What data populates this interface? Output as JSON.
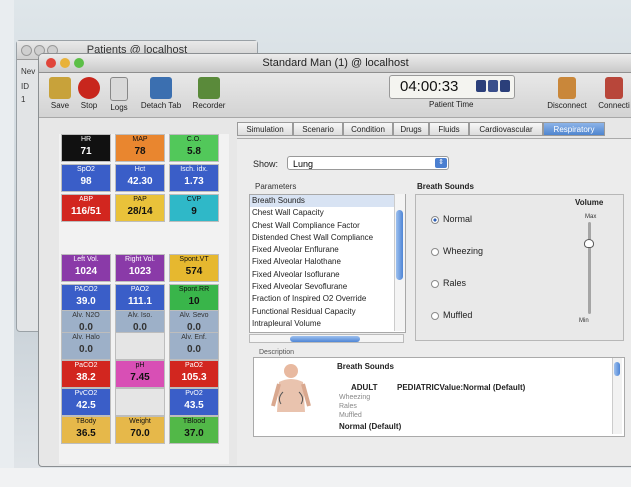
{
  "back_window": {
    "title": "Patients @ localhost",
    "side": [
      "Nev",
      "ID",
      "1"
    ]
  },
  "window": {
    "title": "Standard Man (1) @ localhost"
  },
  "toolbar": {
    "buttons": [
      {
        "label": "Save",
        "icon": "save-icon",
        "color": "#c8a23a"
      },
      {
        "label": "Stop",
        "icon": "stop-icon",
        "color": "#c8261d"
      },
      {
        "label": "Logs",
        "icon": "logs-icon",
        "color": "#d9d9d9"
      },
      {
        "label": "Detach Tab",
        "icon": "detach-tab-icon",
        "color": "#3b6fb0"
      },
      {
        "label": "Recorder",
        "icon": "recorder-icon",
        "color": "#5a8a3a"
      }
    ],
    "clock": "04:00:33",
    "patient_time_label": "Patient Time",
    "disconnect": "Disconnect",
    "connect": "Connecti"
  },
  "vitals": [
    {
      "label": "HR",
      "value": "71",
      "bg": "#111111",
      "fg": "#ffffff"
    },
    {
      "label": "MAP",
      "value": "78",
      "bg": "#e9862f",
      "fg": "#111111"
    },
    {
      "label": "C.O.",
      "value": "5.8",
      "bg": "#52c85a",
      "fg": "#111111"
    },
    {
      "label": "SpO2",
      "value": "98",
      "bg": "#3a5ec8",
      "fg": "#ffffff"
    },
    {
      "label": "Hct",
      "value": "42.30",
      "bg": "#3a5ec8",
      "fg": "#ffffff"
    },
    {
      "label": "Isch. idx.",
      "value": "1.73",
      "bg": "#3a5ec8",
      "fg": "#ffffff"
    },
    {
      "label": "ABP",
      "value": "116/51",
      "bg": "#d2261f",
      "fg": "#ffffff"
    },
    {
      "label": "PAP",
      "value": "28/14",
      "bg": "#e9c23a",
      "fg": "#111111"
    },
    {
      "label": "CVP",
      "value": "9",
      "bg": "#2fb8c8",
      "fg": "#111111"
    },
    {
      "label": "Left Vol.",
      "value": "1024",
      "bg": "#8a3aa8",
      "fg": "#ffffff"
    },
    {
      "label": "Right Vol.",
      "value": "1023",
      "bg": "#8a3aa8",
      "fg": "#ffffff"
    },
    {
      "label": "Spont.VT",
      "value": "574",
      "bg": "#e6b82f",
      "fg": "#111111"
    },
    {
      "label": "PACO2",
      "value": "39.0",
      "bg": "#3a5ec8",
      "fg": "#ffffff"
    },
    {
      "label": "PAO2",
      "value": "111.1",
      "bg": "#3a5ec8",
      "fg": "#ffffff"
    },
    {
      "label": "Spont.RR",
      "value": "10",
      "bg": "#39b54a",
      "fg": "#111111"
    },
    {
      "label": "Alv. N2O",
      "value": "0.0",
      "bg": "#9db0c8",
      "fg": "#333333"
    },
    {
      "label": "Alv. Iso.",
      "value": "0.0",
      "bg": "#9db0c8",
      "fg": "#333333"
    },
    {
      "label": "Alv. Sevo",
      "value": "0.0",
      "bg": "#9db0c8",
      "fg": "#333333"
    },
    {
      "label": "Alv. Halo",
      "value": "0.0",
      "bg": "#9db0c8",
      "fg": "#333333"
    },
    {
      "label": "",
      "value": "",
      "bg": "#e5e5e5",
      "fg": "#333333"
    },
    {
      "label": "Alv. Enf.",
      "value": "0.0",
      "bg": "#9db0c8",
      "fg": "#333333"
    },
    {
      "label": "PaCO2",
      "value": "38.2",
      "bg": "#d2261f",
      "fg": "#ffffff"
    },
    {
      "label": "pH",
      "value": "7.45",
      "bg": "#d84fb5",
      "fg": "#111111"
    },
    {
      "label": "PaO2",
      "value": "105.3",
      "bg": "#d2261f",
      "fg": "#ffffff"
    },
    {
      "label": "PvCO2",
      "value": "42.5",
      "bg": "#3a5ec8",
      "fg": "#ffffff"
    },
    {
      "label": "",
      "value": "",
      "bg": "#e5e5e5",
      "fg": "#333333"
    },
    {
      "label": "PvO2",
      "value": "43.5",
      "bg": "#3a5ec8",
      "fg": "#ffffff"
    },
    {
      "label": "TBody",
      "value": "36.5",
      "bg": "#e6b84a",
      "fg": "#111111"
    },
    {
      "label": "Weight",
      "value": "70.0",
      "bg": "#e6b84a",
      "fg": "#111111"
    },
    {
      "label": "TBlood",
      "value": "37.0",
      "bg": "#52b848",
      "fg": "#111111"
    }
  ],
  "tabs": [
    "Simulation",
    "Scenario",
    "Condition",
    "Drugs",
    "Fluids",
    "Cardiovascular",
    "Respiratory"
  ],
  "active_tab": "Respiratory",
  "show": {
    "label": "Show:",
    "value": "Lung"
  },
  "parameters": {
    "title": "Parameters",
    "items": [
      "Breath Sounds",
      "Chest Wall Capacity",
      "Chest Wall Compliance Factor",
      "Distended Chest Wall Compliance",
      "Fixed Alveolar Enflurane",
      "Fixed Alveolar Halothane",
      "Fixed Alveolar Isoflurane",
      "Fixed Alveolar Sevoflurane",
      "Fraction of Inspired O2 Override",
      "Functional Residual Capacity",
      "Intrapleural Volume"
    ]
  },
  "breath_sounds": {
    "title": "Breath Sounds",
    "options": [
      "Normal",
      "Wheezing",
      "Rales",
      "Muffled"
    ],
    "selected": "Normal",
    "volume_label": "Volume",
    "max_label": "Max",
    "min_label": "Min",
    "volume_level": 0.8
  },
  "description": {
    "title": "Description",
    "heading": "Breath Sounds",
    "adult": "ADULT",
    "pediatric": "PEDIATRICValue:Normal (Default)",
    "lines": [
      "Wheezing",
      "Rales",
      "Muffled"
    ],
    "normal": "Normal (Default)"
  }
}
